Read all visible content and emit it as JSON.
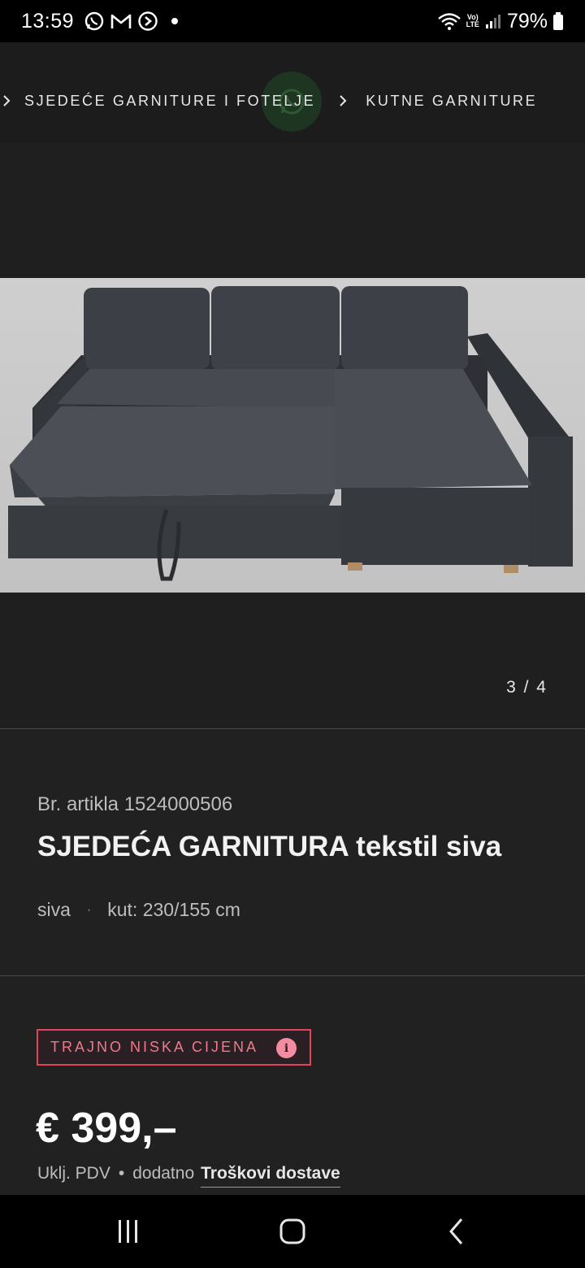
{
  "status_bar": {
    "time": "13:59",
    "battery": "79%",
    "network": "LTE"
  },
  "breadcrumb": {
    "items": [
      "SJEDEĆE GARNITURE I FOTELJE",
      "KUTNE GARNITURE"
    ]
  },
  "gallery": {
    "counter": "3 / 4",
    "image_alt_icon": "sofa-image"
  },
  "product": {
    "article_number": "Br. artikla 1524000506",
    "title_bold": "SJEDEĆA",
    "title_rest": " GARNITURA tekstil siva",
    "color": "siva",
    "dimensions": "kut: 230/155 cm"
  },
  "pricing": {
    "badge": "TRAJNO NISKA CIJENA",
    "price": "€ 399,–",
    "vat_note": "Uklj. PDV",
    "extra_label": "dodatno",
    "shipping_link": "Troškovi dostave"
  },
  "colors": {
    "accent": "#e0445a",
    "background": "#212121"
  }
}
